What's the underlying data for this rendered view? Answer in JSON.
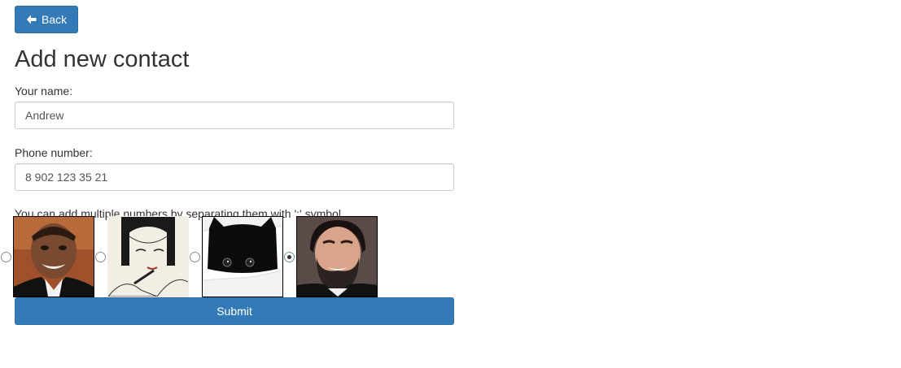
{
  "nav": {
    "back_label": "Back",
    "back_icon": "arrow-left-icon"
  },
  "page": {
    "title": "Add new contact"
  },
  "form": {
    "name_label": "Your name:",
    "name_value": "Andrew",
    "phone_label": "Phone number:",
    "phone_value": "8 902 123 35 21",
    "hint": "You can add multiple numbers by separating them with ':' symbol",
    "avatars": [
      {
        "name": "avatar-option-1",
        "checked": false
      },
      {
        "name": "avatar-option-2",
        "checked": false
      },
      {
        "name": "avatar-option-3",
        "checked": false
      },
      {
        "name": "avatar-option-4",
        "checked": true
      }
    ],
    "submit_label": "Submit"
  },
  "colors": {
    "primary": "#337ab7",
    "primary_border": "#2e6da4",
    "text": "#333333"
  }
}
